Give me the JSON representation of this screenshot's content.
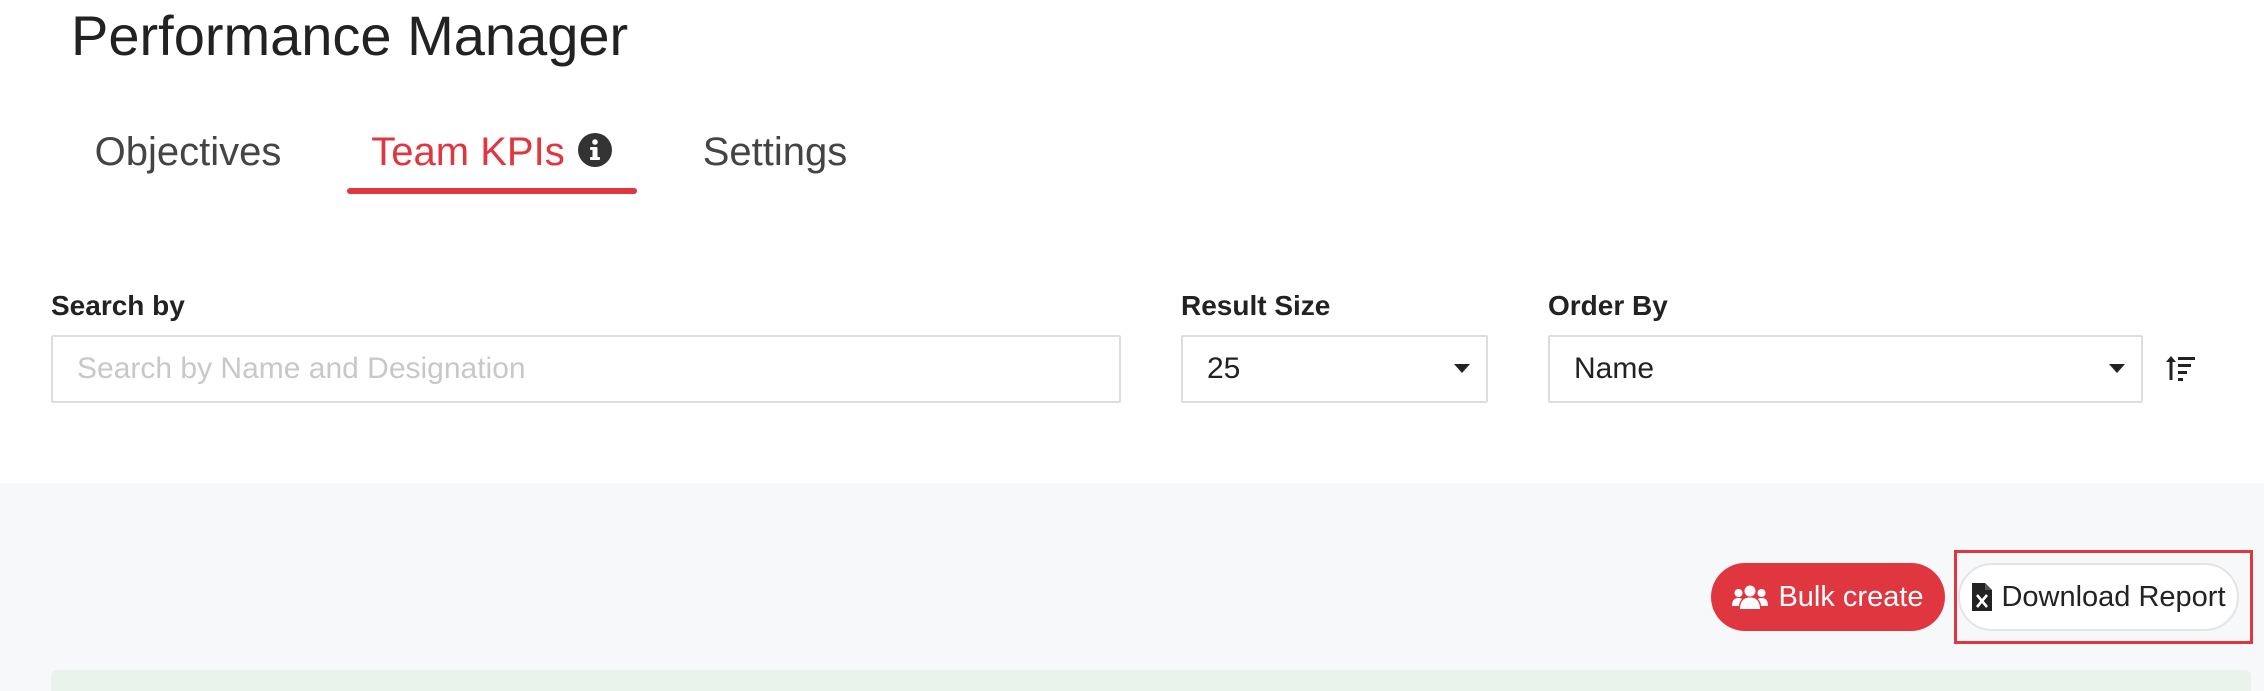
{
  "page": {
    "title": "Performance Manager"
  },
  "tabs": [
    {
      "label": "Objectives",
      "active": false
    },
    {
      "label": "Team KPIs",
      "active": true,
      "icon": "info-icon"
    },
    {
      "label": "Settings",
      "active": false
    }
  ],
  "filters": {
    "search": {
      "label": "Search by",
      "placeholder": "Search by Name and Designation",
      "value": ""
    },
    "result_size": {
      "label": "Result Size",
      "selected": "25"
    },
    "order_by": {
      "label": "Order By",
      "selected": "Name"
    },
    "sort_icon": "sort-ascending-icon"
  },
  "actions": {
    "bulk_create_label": "Bulk create",
    "bulk_create_icon": "users-icon",
    "download_report_label": "Download Report",
    "download_report_icon": "excel-file-icon"
  },
  "colors": {
    "accent": "#e0363f",
    "content_background": "#f6f8fa",
    "list_strip": "#e9f3ec"
  }
}
